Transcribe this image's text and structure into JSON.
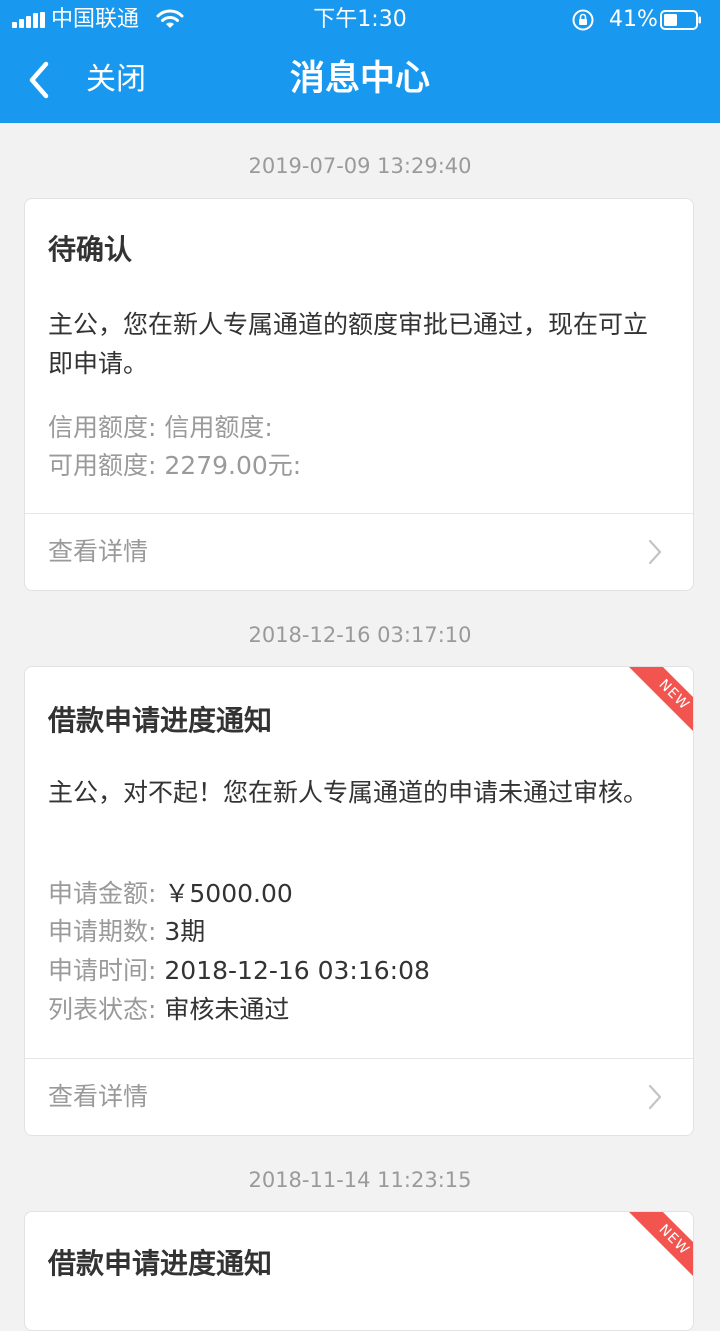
{
  "status_bar": {
    "carrier": "中国联通",
    "time": "下午1:30",
    "battery": "41%"
  },
  "nav": {
    "back_icon": "chevron-left-icon",
    "close_label": "关闭",
    "title": "消息中心"
  },
  "messages": [
    {
      "timestamp": "2019-07-09 13:29:40",
      "title": "待确认",
      "body": "主公，您在新人专属通道的额度审批已通过，现在可立即申请。",
      "badge": "",
      "details": [
        {
          "label": "信用额度:",
          "value": "信用额度:"
        },
        {
          "label": "可用额度:",
          "value": "2279.00元:"
        }
      ],
      "link_label": "查看详情"
    },
    {
      "timestamp": "2018-12-16 03:17:10",
      "title": "借款申请进度通知",
      "body": "主公，对不起！您在新人专属通道的申请未通过审核。",
      "badge": "NEW",
      "details": [
        {
          "label": "申请金额:",
          "value": "￥5000.00"
        },
        {
          "label": "申请期数:",
          "value": "3期"
        },
        {
          "label": "申请时间:",
          "value": "2018-12-16 03:16:08"
        },
        {
          "label": "列表状态:",
          "value": "审核未通过"
        }
      ],
      "link_label": "查看详情"
    },
    {
      "timestamp": "2018-11-14 11:23:15",
      "title": "借款申请进度通知",
      "badge": "NEW"
    }
  ],
  "colors": {
    "header": "#1898ee",
    "background": "#f2f2f2",
    "ribbon": "#f2554f"
  }
}
